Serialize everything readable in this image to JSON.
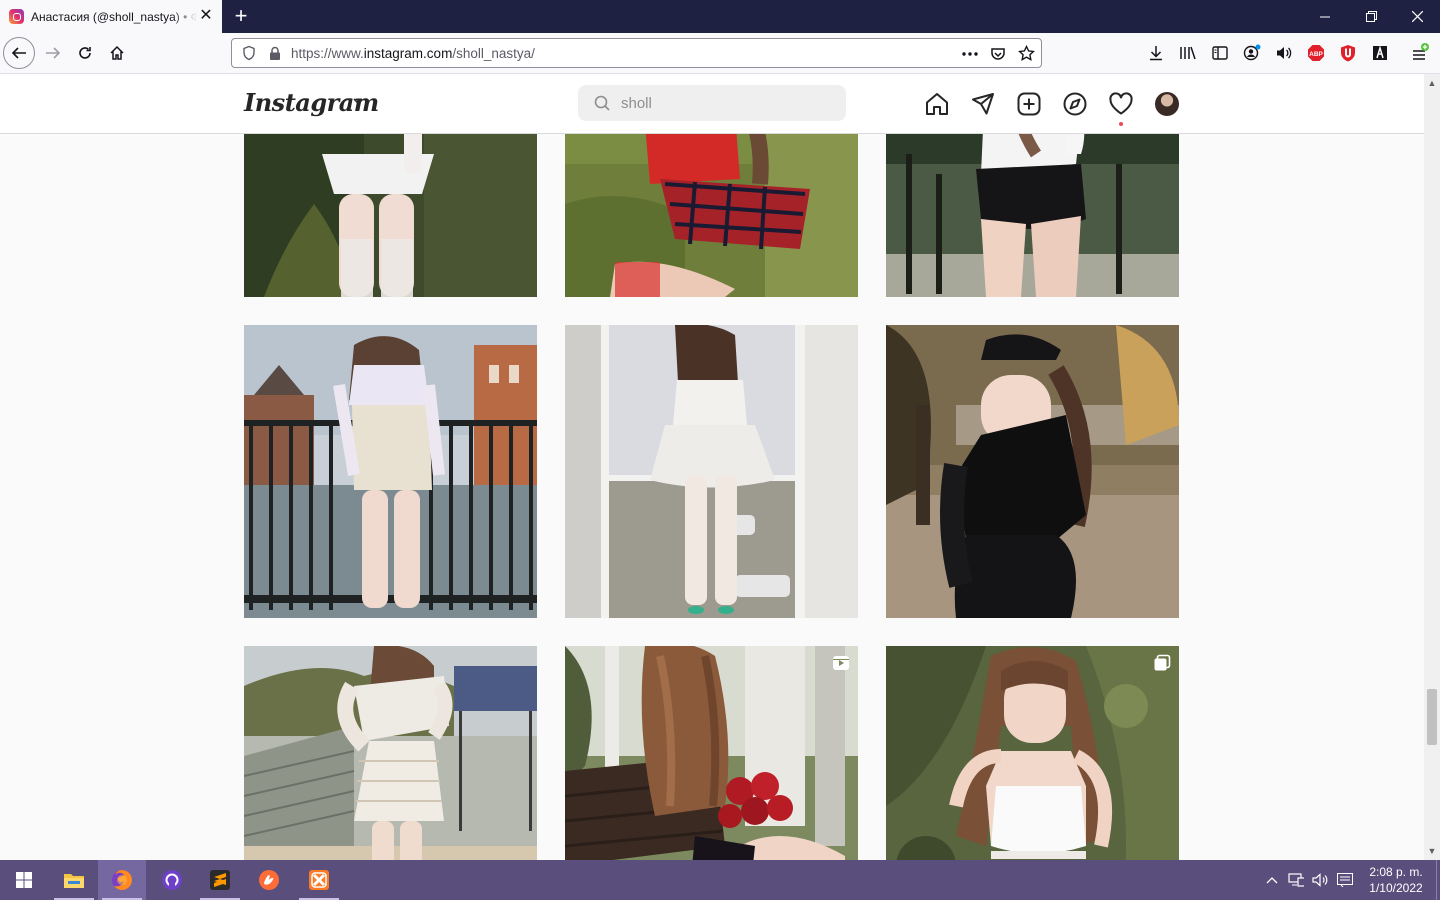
{
  "browser": {
    "tab_title": "Анастасия (@sholl_nastya) • Фото и видео в Instagram",
    "url_prefix": "https://www.",
    "url_domain": "instagram.com",
    "url_path": "/sholl_nastya/"
  },
  "instagram": {
    "logo": "Instagram",
    "search_value": "sholl",
    "nav_icons": [
      "home-icon",
      "direct-icon",
      "new-post-icon",
      "explore-icon",
      "activity-icon",
      "profile-avatar"
    ]
  },
  "posts": [
    {
      "id": "post-1",
      "subject": "white-dress-fishnet",
      "badge": null
    },
    {
      "id": "post-2",
      "subject": "red-plaid-skirt",
      "badge": null
    },
    {
      "id": "post-3",
      "subject": "black-shorts-park",
      "badge": null
    },
    {
      "id": "post-4",
      "subject": "bridge-river",
      "badge": null
    },
    {
      "id": "post-5",
      "subject": "window-white-dress",
      "badge": null
    },
    {
      "id": "post-6",
      "subject": "black-leather-jacket",
      "badge": null
    },
    {
      "id": "post-7",
      "subject": "white-lace-outfit",
      "badge": null
    },
    {
      "id": "post-8",
      "subject": "bench-roses",
      "badge": "video-icon"
    },
    {
      "id": "post-9",
      "subject": "white-top-greenery",
      "badge": "carousel-icon"
    }
  ],
  "taskbar": {
    "apps": [
      "file-explorer-icon",
      "firefox-icon",
      "github-desktop-icon",
      "sublime-text-icon",
      "postman-icon",
      "xampp-icon"
    ],
    "time": "2:08 p. m.",
    "date": "1/10/2022"
  },
  "colors": {
    "accent_notification": "#ed4956",
    "taskbar": "#5a4f7c",
    "tabstrip": "#1f2142"
  }
}
